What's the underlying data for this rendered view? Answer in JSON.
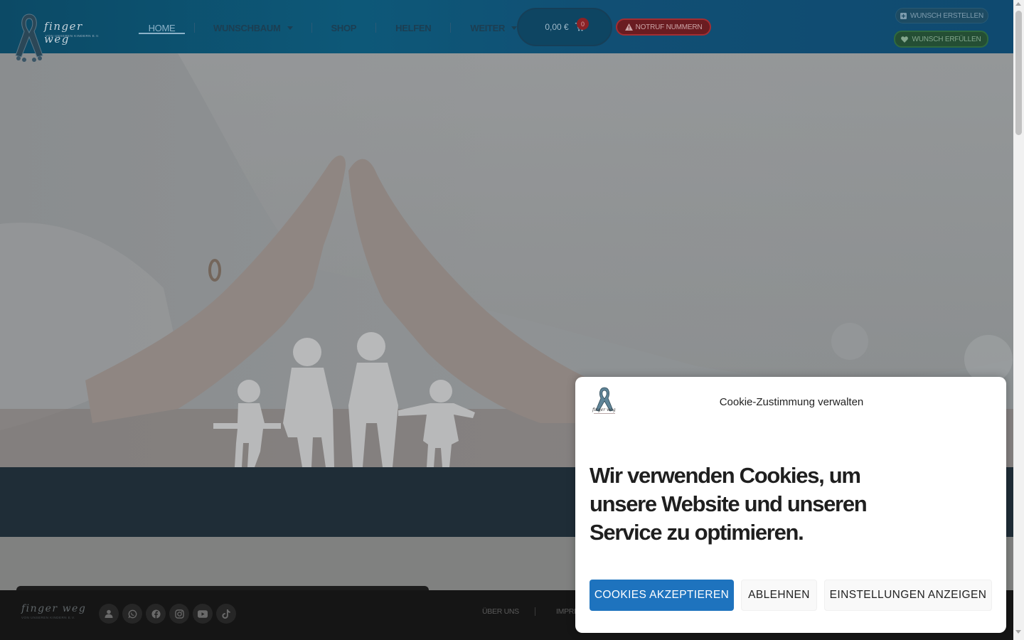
{
  "header": {
    "brand": "finger weg",
    "brand_sub": "VON UNSEREN KINDERN E.V.",
    "nav": [
      {
        "label": "HOME",
        "active": true,
        "dropdown": false
      },
      {
        "label": "WUNSCHBAUM",
        "active": false,
        "dropdown": true
      },
      {
        "label": "SHOP",
        "active": false,
        "dropdown": false
      },
      {
        "label": "HELFEN",
        "active": false,
        "dropdown": false
      },
      {
        "label": "WEITER",
        "active": false,
        "dropdown": true
      }
    ],
    "cart_total": "0,00 €",
    "cart_count": "0",
    "notruf_label": "NOTRUF NUMMERN",
    "wunsch_erstellen_label": "WUNSCH ERSTELLEN",
    "wunsch_erfuellen_label": "WUNSCH ERFÜLLEN"
  },
  "hero": {
    "image_icon": "hands-roof-family-image"
  },
  "footer": {
    "brand": "finger weg",
    "brand_sub": "VON UNSEREN KINDERN E.V.",
    "social_icons": [
      "user-icon",
      "whatsapp-icon",
      "facebook-icon",
      "instagram-icon",
      "youtube-icon",
      "tiktok-icon"
    ],
    "links": [
      "ÜBER UNS",
      "IMPRE"
    ]
  },
  "cookie_dialog": {
    "title": "Cookie-Zustimmung verwalten",
    "message": "Wir verwenden Cookies, um unsere Website und unseren Service zu optimieren.",
    "accept_label": "COOKIES AKZEPTIEREN",
    "deny_label": "ABLEHNEN",
    "settings_label": "EINSTELLUNGEN ANZEIGEN",
    "accept_color": "#1e73be"
  },
  "colors": {
    "header_bg": "#0d5878",
    "overlay_dark": "#1f2d37",
    "footer_bg": "#151515",
    "notruf_red": "#a32e33",
    "wunsch_green": "#2f6a3f"
  }
}
